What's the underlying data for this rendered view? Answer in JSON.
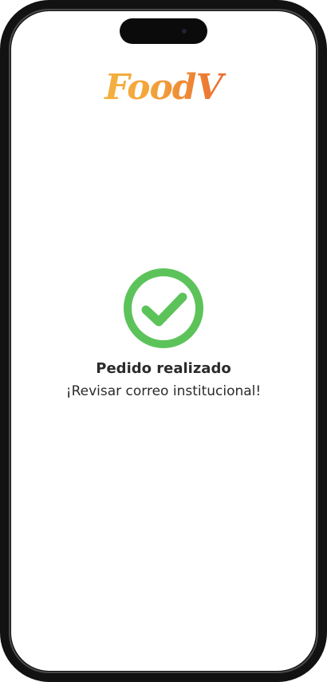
{
  "app": {
    "logo_text": "FoodV"
  },
  "status": {
    "icon": "check-circle-icon",
    "title": "Pedido realizado",
    "subtitle": "¡Revisar correo institucional!"
  },
  "colors": {
    "success": "#5cc35a",
    "logo_gradient": [
      "#f7c948",
      "#f3a53a",
      "#e8632e",
      "#c9302c"
    ],
    "text": "#2b2b2b"
  }
}
